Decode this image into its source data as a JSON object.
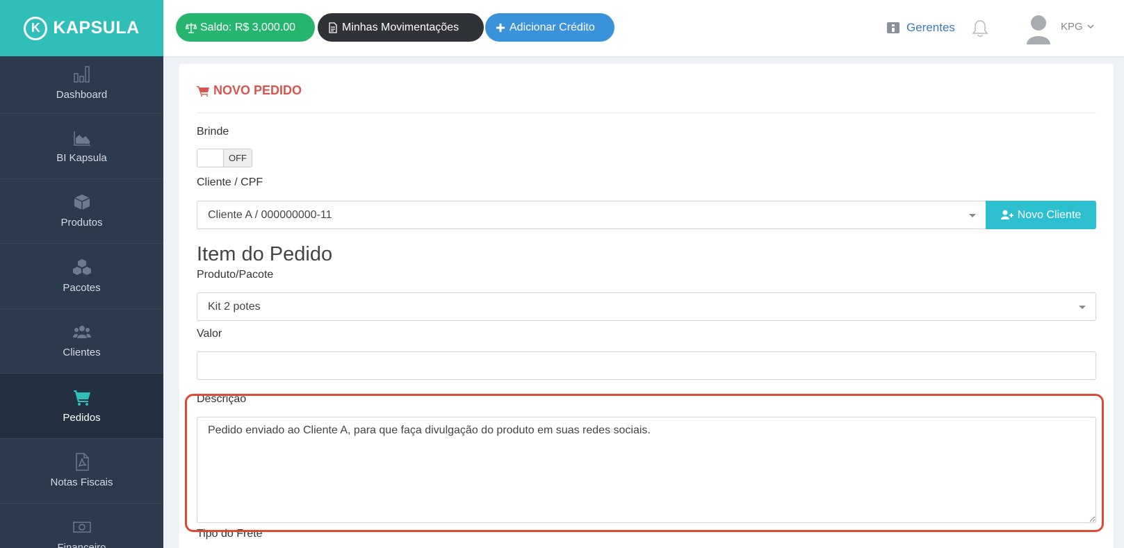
{
  "brand": {
    "name": "KAPSULA",
    "badge": "K"
  },
  "sidebar": {
    "items": [
      {
        "label": "Dashboard",
        "icon": "bar-chart-icon"
      },
      {
        "label": "BI Kapsula",
        "icon": "area-chart-icon"
      },
      {
        "label": "Produtos",
        "icon": "cube-icon"
      },
      {
        "label": "Pacotes",
        "icon": "cubes-icon"
      },
      {
        "label": "Clientes",
        "icon": "users-icon"
      },
      {
        "label": "Pedidos",
        "icon": "cart-icon",
        "active": true
      },
      {
        "label": "Notas Fiscais",
        "icon": "pdf-file-icon"
      },
      {
        "label": "Financeiro",
        "icon": "money-icon"
      }
    ]
  },
  "topbar": {
    "saldo": "Saldo: R$ 3,000.00",
    "movimentacoes": "Minhas Movimentações",
    "adicionar": "Adicionar Crédito",
    "gerentes": "Gerentes",
    "user": "KPG"
  },
  "form": {
    "title": "NOVO PEDIDO",
    "brinde_label": "Brinde",
    "brinde_state": "OFF",
    "cliente_label": "Cliente / CPF",
    "cliente_value": "Cliente A / 000000000-11",
    "novo_cliente": "Novo Cliente",
    "item_heading": "Item do Pedido",
    "produto_label": "Produto/Pacote",
    "produto_value": "Kit 2 potes",
    "valor_label": "Valor",
    "valor_value": "",
    "descricao_label": "Descrição",
    "descricao_value": "Pedido enviado ao Cliente A, para que faça divulgação do produto em suas redes sociais.",
    "frete_label": "Tipo do Frete"
  },
  "colors": {
    "sidebar_bg": "#2b3a4c",
    "brand_teal": "#2fbfb8",
    "active_icon": "#2fbfb8",
    "saldo_green": "#26b56e",
    "credit_blue": "#3a92da",
    "title_red": "#d9534f",
    "highlight_red": "#dc4a36"
  }
}
